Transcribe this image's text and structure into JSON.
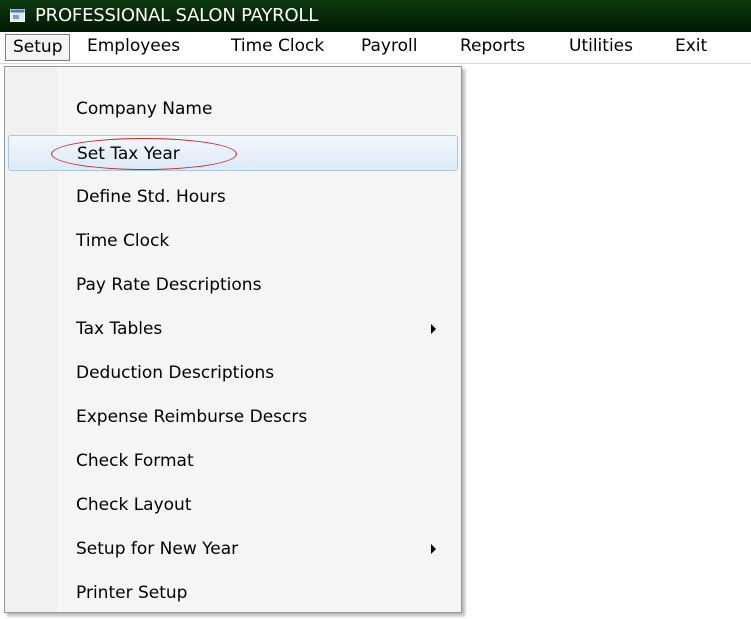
{
  "window": {
    "title": "PROFESSIONAL SALON PAYROLL",
    "app_icon": "app-window-icon"
  },
  "menubar": {
    "items": [
      {
        "label": "Setup",
        "active": true
      },
      {
        "label": "Employees"
      },
      {
        "label": "Time Clock"
      },
      {
        "label": "Payroll"
      },
      {
        "label": "Reports"
      },
      {
        "label": "Utilities"
      },
      {
        "label": "Exit"
      }
    ]
  },
  "setup_menu": {
    "items": [
      {
        "label": "Company Name"
      },
      {
        "label": "Set Tax Year",
        "selected": true,
        "annotated": true
      },
      {
        "label": "Define Std. Hours"
      },
      {
        "label": "Time Clock"
      },
      {
        "label": "Pay Rate Descriptions"
      },
      {
        "label": "Tax Tables",
        "submenu": true
      },
      {
        "label": "Deduction Descriptions"
      },
      {
        "label": "Expense Reimburse Descrs"
      },
      {
        "label": "Check Format"
      },
      {
        "label": "Check Layout"
      },
      {
        "label": "Setup for New Year",
        "submenu": true
      },
      {
        "label": "Printer Setup"
      }
    ]
  },
  "colors": {
    "titlebar": "#062608",
    "selection": "#dceaf8",
    "annotation": "#d42020"
  }
}
